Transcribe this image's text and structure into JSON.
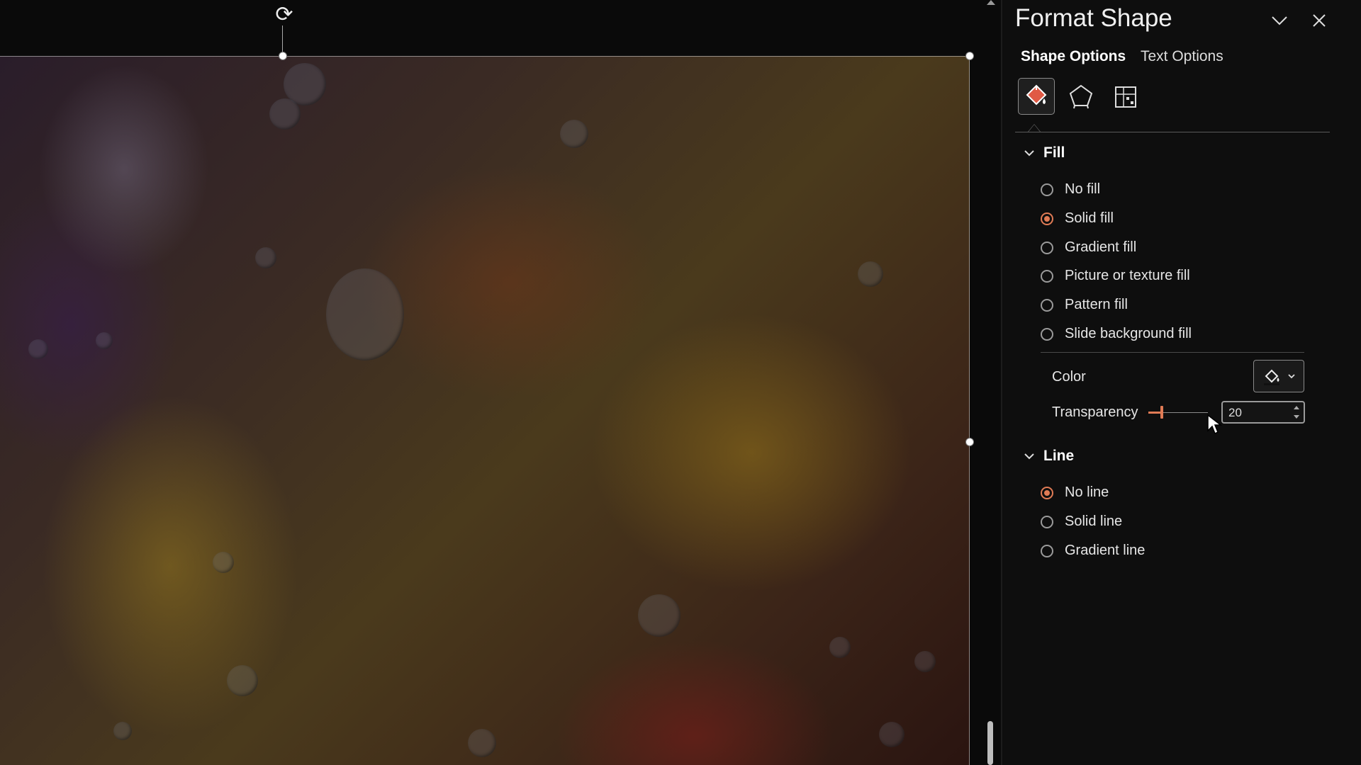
{
  "pane": {
    "title": "Format Shape",
    "tabs": [
      {
        "label": "Shape Options",
        "active": true
      },
      {
        "label": "Text Options",
        "active": false
      }
    ],
    "categories": [
      "fill-line-icon",
      "effects-icon",
      "size-properties-icon"
    ],
    "fill": {
      "heading": "Fill",
      "options": [
        {
          "label": "No fill",
          "selected": false
        },
        {
          "label": "Solid fill",
          "selected": true
        },
        {
          "label": "Gradient fill",
          "selected": false
        },
        {
          "label": "Picture or texture fill",
          "selected": false
        },
        {
          "label": "Pattern fill",
          "selected": false
        },
        {
          "label": "Slide background fill",
          "selected": false
        }
      ],
      "color_label": "Color",
      "transparency_label": "Transparency",
      "transparency_value": "20"
    },
    "line": {
      "heading": "Line",
      "options": [
        {
          "label": "No line",
          "selected": true
        },
        {
          "label": "Solid line",
          "selected": false
        },
        {
          "label": "Gradient line",
          "selected": false
        }
      ]
    }
  },
  "colors": {
    "accent": "#e07b55",
    "pane_bg": "#0e0e0e"
  }
}
